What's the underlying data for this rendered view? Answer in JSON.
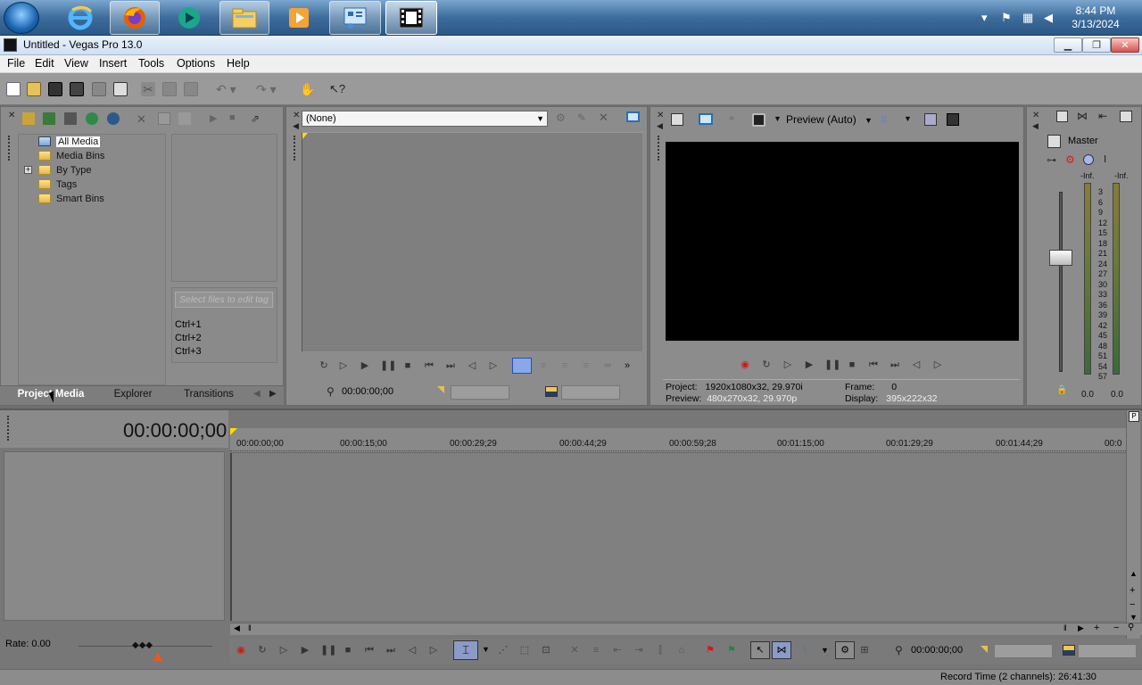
{
  "taskbar": {
    "clock_time": "8:44 PM",
    "clock_date": "3/13/2024",
    "apps": [
      "start-orb",
      "internet-explorer",
      "firefox",
      "media-app",
      "file-explorer",
      "media-player",
      "control-panel",
      "vegas-pro"
    ]
  },
  "window": {
    "title": "Untitled - Vegas Pro 13.0"
  },
  "menu": {
    "file": "File",
    "edit": "Edit",
    "view": "View",
    "insert": "Insert",
    "tools": "Tools",
    "options": "Options",
    "help": "Help"
  },
  "project_media": {
    "tree": [
      "All Media",
      "Media Bins",
      "By Type",
      "Tags",
      "Smart Bins"
    ],
    "tag_placeholder": "Select files to edit tag",
    "shortcuts": [
      "Ctrl+1",
      "Ctrl+2",
      "Ctrl+3"
    ],
    "tabs": [
      "Project Media",
      "Explorer",
      "Transitions"
    ]
  },
  "trimmer": {
    "dropdown_value": "(None)",
    "timecode": "00:00:00;00"
  },
  "preview": {
    "mode": "Preview (Auto)",
    "project_label": "Project:",
    "project_value": "1920x1080x32, 29.970i",
    "preview_label": "Preview:",
    "preview_value": "480x270x32, 29.970p",
    "frame_label": "Frame:",
    "frame_value": "0",
    "display_label": "Display:",
    "display_value": "395x222x32"
  },
  "master": {
    "title": "Master",
    "left_peak": "-Inf.",
    "right_peak": "-Inf.",
    "scale": [
      "3",
      "6",
      "9",
      "12",
      "15",
      "18",
      "21",
      "24",
      "27",
      "30",
      "33",
      "36",
      "39",
      "42",
      "45",
      "48",
      "51",
      "54",
      "57"
    ],
    "left_value": "0.0",
    "right_value": "0.0"
  },
  "timeline": {
    "timecode": "00:00:00;00",
    "ruler": [
      "00:00:00;00",
      "00:00:15;00",
      "00:00:29;29",
      "00:00:44;29",
      "00:00:59;28",
      "00:01:15;00",
      "00:01:29;29",
      "00:01:44;29",
      "00:0"
    ],
    "rate_label": "Rate: 0.00",
    "bottom_timecode": "00:00:00;00"
  },
  "status": {
    "record_time": "Record Time (2 channels): 26:41:30"
  }
}
